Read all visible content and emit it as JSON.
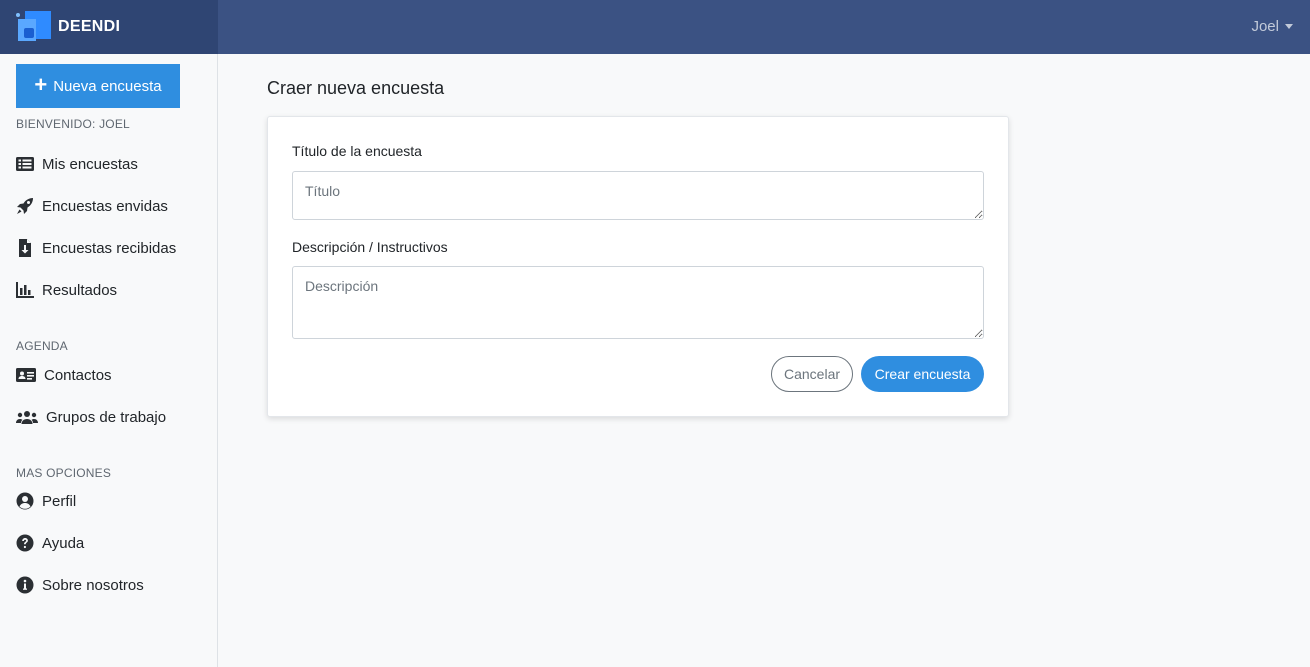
{
  "header": {
    "brand": "DEENDI",
    "user": "Joel"
  },
  "sidebar": {
    "new_button": "Nueva encuesta",
    "welcome": "BIENVENIDO: JOEL",
    "surveys": [
      {
        "label": "Mis encuestas",
        "icon": "list-icon"
      },
      {
        "label": "Encuestas envidas",
        "icon": "rocket-icon"
      },
      {
        "label": "Encuestas recibidas",
        "icon": "file-download-icon"
      },
      {
        "label": "Resultados",
        "icon": "chart-bar-icon"
      }
    ],
    "agenda_label": "AGENDA",
    "agenda": [
      {
        "label": "Contactos",
        "icon": "address-card-icon"
      },
      {
        "label": "Grupos de trabajo",
        "icon": "users-icon"
      }
    ],
    "more_label": "MAS OPCIONES",
    "more": [
      {
        "label": "Perfil",
        "icon": "user-circle-icon"
      },
      {
        "label": "Ayuda",
        "icon": "question-circle-icon"
      },
      {
        "label": "Sobre nosotros",
        "icon": "info-circle-icon"
      }
    ]
  },
  "main": {
    "title": "Craer nueva encuesta",
    "form": {
      "title_label": "Título de la encuesta",
      "title_placeholder": "Título",
      "title_value": "",
      "description_label": "Descripción / Instructivos",
      "description_placeholder": "Descripción",
      "description_value": "",
      "cancel_label": "Cancelar",
      "create_label": "Crear encuesta"
    }
  },
  "colors": {
    "topbar": "#3b5283",
    "brand_bg": "#2f4573",
    "primary": "#2f8ee0"
  }
}
